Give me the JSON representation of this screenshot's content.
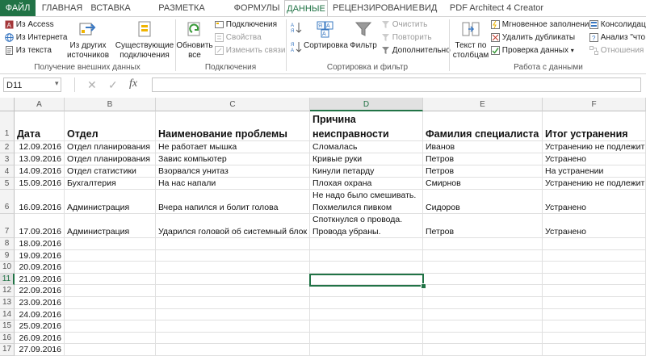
{
  "tabs": [
    "ФАЙЛ",
    "ГЛАВНАЯ",
    "ВСТАВКА",
    "РАЗМЕТКА СТРАНИЦЫ",
    "ФОРМУЛЫ",
    "ДАННЫЕ",
    "РЕЦЕНЗИРОВАНИЕ",
    "ВИД",
    "PDF Architect 4 Creator"
  ],
  "active_tab": "ДАННЫЕ",
  "ribbon": {
    "external": {
      "access": "Из Access",
      "web": "Из Интернета",
      "text": "Из текста",
      "other_line1": "Из других",
      "other_line2": "источников",
      "existing_line1": "Существующие",
      "existing_line2": "подключения",
      "label": "Получение внешних данных"
    },
    "connections": {
      "refresh_line1": "Обновить",
      "refresh_line2": "все",
      "conn": "Подключения",
      "props": "Свойства",
      "edit_links": "Изменить связи",
      "label": "Подключения"
    },
    "sort_filter": {
      "sort": "Сортировка",
      "filter": "Фильтр",
      "clear": "Очистить",
      "reapply": "Повторить",
      "advanced": "Дополнительно",
      "label": "Сортировка и фильтр"
    },
    "data_tools": {
      "text_cols_line1": "Текст по",
      "text_cols_line2": "столбцам",
      "flash_fill": "Мгновенное заполнение",
      "remove_dup": "Удалить дубликаты",
      "validation": "Проверка данных",
      "consolidate": "Консолидаци",
      "whatif": "Анализ \"что е",
      "relations": "Отношения",
      "label": "Работа с данными"
    }
  },
  "name_box": "D11",
  "fx_label": "fx",
  "columns": [
    "A",
    "B",
    "C",
    "D",
    "E",
    "F"
  ],
  "selected_column": "D",
  "selected_row": "11",
  "header_row": {
    "num": "1",
    "a": "Дата",
    "b": "Отдел",
    "c": "Наименование проблемы",
    "d_line1": "Причина",
    "d_line2": "неисправности",
    "e": "Фамилия специалиста",
    "f": "Итог устранения"
  },
  "rows": [
    {
      "num": "2",
      "a": "12.09.2016",
      "b": "Отдел планирования",
      "c": "Не работает мышка",
      "d": "Сломалась",
      "e": "Иванов",
      "f": "Устранению не подлежит"
    },
    {
      "num": "3",
      "a": "13.09.2016",
      "b": "Отдел планирования",
      "c": "Завис компьютер",
      "d": "Кривые руки",
      "e": "Петров",
      "f": "Устранено"
    },
    {
      "num": "4",
      "a": "14.09.2016",
      "b": "Отдел статистики",
      "c": "Взорвался унитаз",
      "d": "Кинули петарду",
      "e": "Петров",
      "f": "На устранении"
    },
    {
      "num": "5",
      "a": "15.09.2016",
      "b": "Бухгалтерия",
      "c": "На нас напали",
      "d": "Плохая охрана",
      "e": "Смирнов",
      "f": "Устранению не подлежит"
    },
    {
      "num": "6",
      "a": "16.09.2016",
      "b": "Администрация",
      "c": "Вчера напился и болит голова",
      "d_line1": "Не надо было смешивать.",
      "d_line2": "Похмелился пивком",
      "e": "Сидоров",
      "f": "Устранено"
    },
    {
      "num": "7",
      "a": "17.09.2016",
      "b": "Администрация",
      "c": "Ударился головой об системный блок",
      "d_line1": "Споткнулся о провода.",
      "d_line2": "Провода убраны.",
      "e": "Петров",
      "f": "Устранено"
    },
    {
      "num": "8",
      "a": "18.09.2016"
    },
    {
      "num": "9",
      "a": "19.09.2016"
    },
    {
      "num": "10",
      "a": "20.09.2016"
    },
    {
      "num": "11",
      "a": "21.09.2016"
    },
    {
      "num": "12",
      "a": "22.09.2016"
    },
    {
      "num": "13",
      "a": "23.09.2016"
    },
    {
      "num": "14",
      "a": "24.09.2016"
    },
    {
      "num": "15",
      "a": "25.09.2016"
    },
    {
      "num": "16",
      "a": "26.09.2016"
    },
    {
      "num": "17",
      "a": "27.09.2016"
    }
  ]
}
